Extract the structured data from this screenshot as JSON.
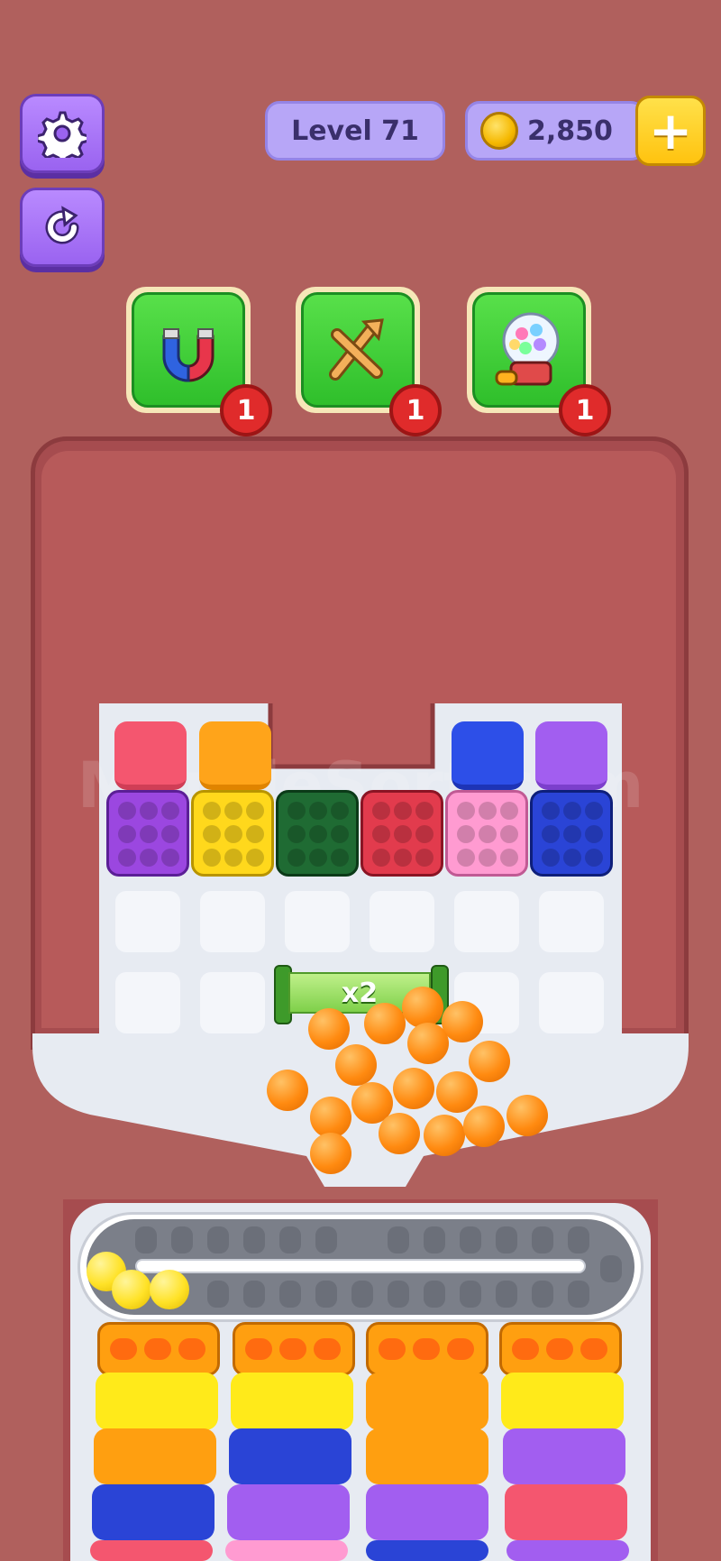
{
  "hud": {
    "level_label": "Level 71",
    "coins": "2,850",
    "add_coins_symbol": "+"
  },
  "boosters": [
    {
      "name": "magnet",
      "count": "1"
    },
    {
      "name": "shuffle",
      "count": "1"
    },
    {
      "name": "gumball-machine",
      "count": "1"
    }
  ],
  "board": {
    "multiplier_label": "x2",
    "watermark": "MarbleSort.com"
  },
  "colors": {
    "background": "#b0605d",
    "pink": "#f4566f",
    "orange": "#ff9f10",
    "purple": "#9b47e0",
    "yellow": "#ffd81c",
    "green": "#1f6b33",
    "red": "#e23b4d",
    "light_pink": "#ff9bd1",
    "blue": "#2a44d6"
  }
}
